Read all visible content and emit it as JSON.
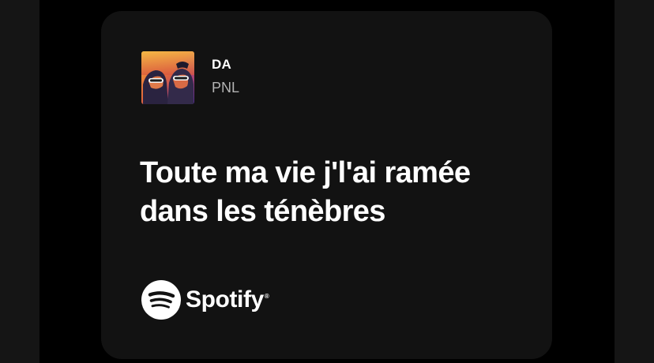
{
  "song": {
    "title": "DA",
    "artist": "PNL",
    "cover_icon": "album-cover"
  },
  "lyrics": {
    "line1": "Toute ma vie j'l'ai ramée",
    "line2": "dans les ténèbres"
  },
  "brand": {
    "name": "Spotify",
    "registered": "®",
    "icon": "spotify-logo-icon"
  },
  "colors": {
    "background": "#000000",
    "card": "#121212",
    "side_panel": "#151515",
    "text_primary": "#ffffff",
    "text_secondary": "#b3b3b3"
  }
}
